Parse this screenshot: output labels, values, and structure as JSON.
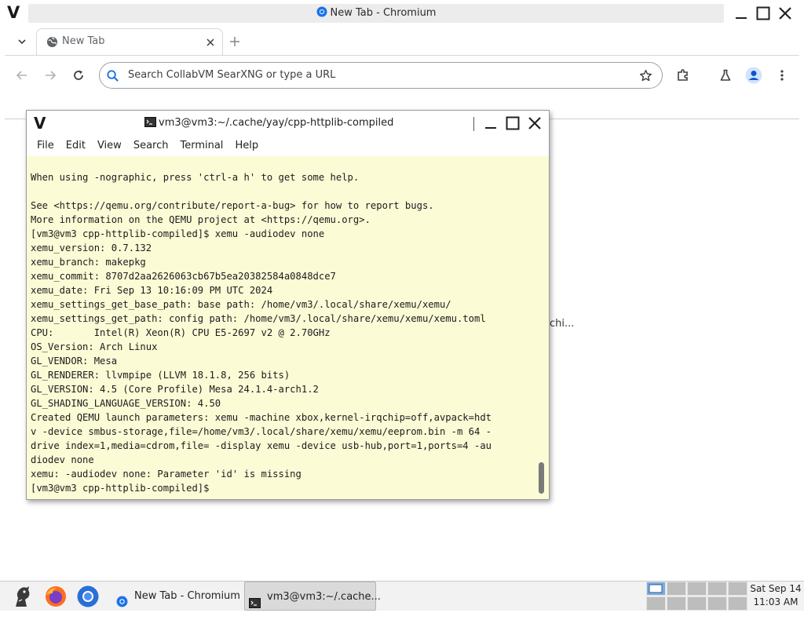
{
  "browser": {
    "window_title": "New Tab - Chromium",
    "tabs": [
      {
        "label": "New Tab"
      }
    ],
    "omnibox": {
      "placeholder": "Search CollabVM SearXNG or type a URL",
      "value": ""
    },
    "background_fragment": "chi..."
  },
  "terminal": {
    "title": "vm3@vm3:~/.cache/yay/cpp-httplib-compiled",
    "menu": [
      "File",
      "Edit",
      "View",
      "Search",
      "Terminal",
      "Help"
    ],
    "lines": [
      "When using -nographic, press 'ctrl-a h' to get some help.",
      "",
      "See <https://qemu.org/contribute/report-a-bug> for how to report bugs.",
      "More information on the QEMU project at <https://qemu.org>.",
      "[vm3@vm3 cpp-httplib-compiled]$ xemu -audiodev none",
      "xemu_version: 0.7.132",
      "xemu_branch: makepkg",
      "xemu_commit: 8707d2aa2626063cb67b5ea20382584a0848dce7",
      "xemu_date: Fri Sep 13 10:16:09 PM UTC 2024",
      "xemu_settings_get_base_path: base path: /home/vm3/.local/share/xemu/xemu/",
      "xemu_settings_get_path: config path: /home/vm3/.local/share/xemu/xemu/xemu.toml",
      "CPU:       Intel(R) Xeon(R) CPU E5-2697 v2 @ 2.70GHz",
      "OS_Version: Arch Linux",
      "GL_VENDOR: Mesa",
      "GL_RENDERER: llvmpipe (LLVM 18.1.8, 256 bits)",
      "GL_VERSION: 4.5 (Core Profile) Mesa 24.1.4-arch1.2",
      "GL_SHADING_LANGUAGE_VERSION: 4.50",
      "Created QEMU launch parameters: xemu -machine xbox,kernel-irqchip=off,avpack=hdt",
      "v -device smbus-storage,file=/home/vm3/.local/share/xemu/xemu/eeprom.bin -m 64 -",
      "drive index=1,media=cdrom,file= -display xemu -device usb-hub,port=1,ports=4 -au",
      "diodev none",
      "xemu: -audiodev none: Parameter 'id' is missing",
      "[vm3@vm3 cpp-httplib-compiled]$ "
    ]
  },
  "taskbar": {
    "tasks": [
      {
        "label": "New Tab - Chromium"
      },
      {
        "label": "vm3@vm3:~/.cache..."
      }
    ],
    "clock": {
      "date": "Sat Sep 14",
      "time": "11:03 AM"
    }
  },
  "colors": {
    "terminal_bg": "#fbfbd6",
    "chrome_blue": "#1a73e8",
    "pager_active": "#7aaee0"
  }
}
